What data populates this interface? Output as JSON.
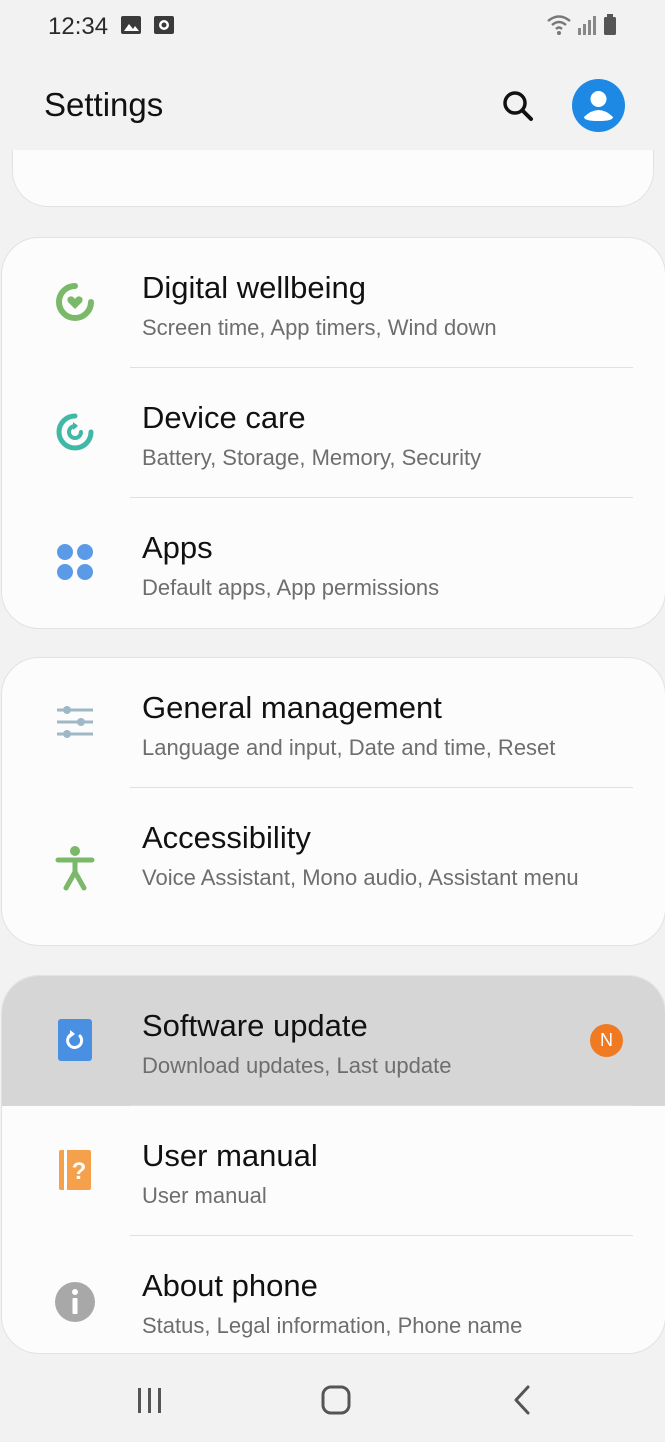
{
  "status_bar": {
    "time": "12:34",
    "icons": [
      "image-icon",
      "recorder-icon",
      "wifi-icon",
      "signal-icon",
      "battery-icon"
    ]
  },
  "header": {
    "title": "Settings",
    "search_icon": "search-icon",
    "account_icon": "account-icon",
    "accent_color": "#1e88e5"
  },
  "groups": [
    {
      "items": [
        {
          "title": "Digital wellbeing",
          "subtitle": "Screen time, App timers, Wind down",
          "icon": "digital-wellbeing-icon",
          "color": "#7ab86a"
        },
        {
          "title": "Device care",
          "subtitle": "Battery, Storage, Memory, Security",
          "icon": "device-care-icon",
          "color": "#3fb8a5"
        },
        {
          "title": "Apps",
          "subtitle": "Default apps, App permissions",
          "icon": "apps-icon",
          "color": "#5b9ae6"
        }
      ]
    },
    {
      "items": [
        {
          "title": "General management",
          "subtitle": "Language and input, Date and time, Reset",
          "icon": "sliders-icon",
          "color": "#9eb8c6"
        },
        {
          "title": "Accessibility",
          "subtitle": "Voice Assistant, Mono audio, Assistant menu",
          "icon": "accessibility-icon",
          "color": "#7ab86a"
        }
      ]
    },
    {
      "items": [
        {
          "title": "Software update",
          "subtitle": "Download updates, Last update",
          "icon": "software-update-icon",
          "color": "#4a90e2",
          "badge": "N",
          "badge_color": "#f07a22",
          "highlighted": true
        },
        {
          "title": "User manual",
          "subtitle": "User manual",
          "icon": "user-manual-icon",
          "color": "#f5a04a"
        },
        {
          "title": "About phone",
          "subtitle": "Status, Legal information, Phone name",
          "icon": "info-icon",
          "color": "#a8a8a8"
        }
      ]
    }
  ],
  "nav_bar": {
    "buttons": [
      "recent-apps-icon",
      "home-icon",
      "back-icon"
    ]
  }
}
